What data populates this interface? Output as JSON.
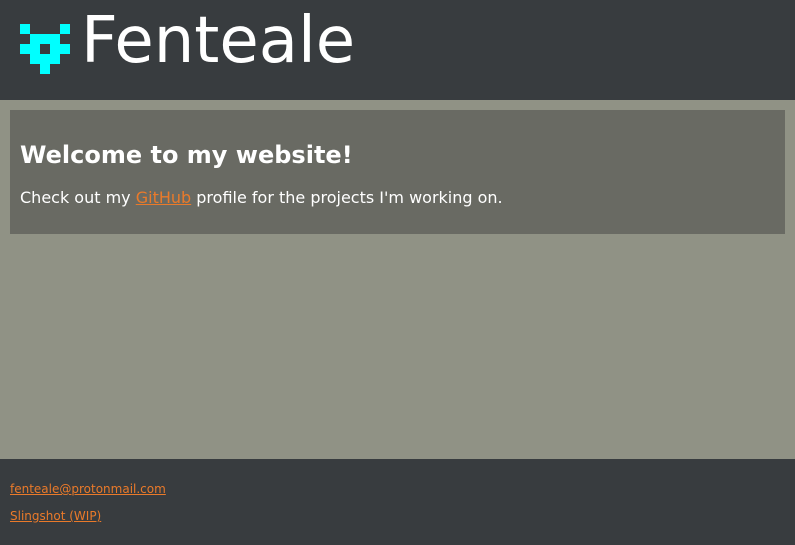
{
  "header": {
    "logo_icon": "pixel-creature-icon",
    "logo_color": "#00ffff",
    "title": "Fenteale"
  },
  "main": {
    "heading": "Welcome to my website!",
    "intro_before": "Check out my ",
    "github_link_label": "GitHub",
    "intro_after": " profile for the projects I'm working on."
  },
  "footer": {
    "email_link": "fenteale@protonmail.com",
    "project_link": "Slingshot (WIP)"
  },
  "colors": {
    "header_bg": "#383c3f",
    "page_bg": "#909285",
    "card_bg": "#696a63",
    "link": "#ea7a2a",
    "text": "#ffffff"
  }
}
